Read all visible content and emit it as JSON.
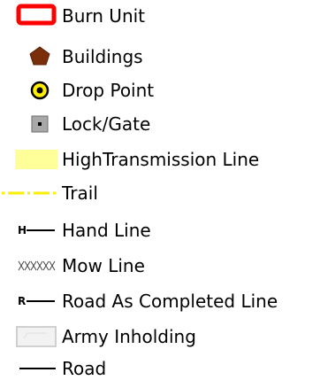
{
  "legend": {
    "items": [
      {
        "label": "Burn Unit",
        "icon": "burn-unit-icon",
        "color": "#ff0000"
      },
      {
        "label": "Buildings",
        "icon": "building-icon",
        "color": "#7a2e0a"
      },
      {
        "label": "Drop Point",
        "icon": "drop-point-icon",
        "color": "#ffee00"
      },
      {
        "label": "Lock/Gate",
        "icon": "lock-gate-icon",
        "color": "#a8a8a8"
      },
      {
        "label": "HighTransmission Line",
        "icon": "transmission-line-icon",
        "color": "#ffff99"
      },
      {
        "label": "Trail",
        "icon": "trail-icon",
        "color": "#ffee00"
      },
      {
        "label": "Hand Line",
        "icon": "hand-line-icon",
        "color": "#000000",
        "letter": "H"
      },
      {
        "label": "Mow Line",
        "icon": "mow-line-icon",
        "color": "#444444"
      },
      {
        "label": "Road As Completed Line",
        "icon": "road-completed-line-icon",
        "color": "#000000",
        "letter": "R"
      },
      {
        "label": "Army Inholding",
        "icon": "army-inholding-icon",
        "color": "#d9d9d9"
      },
      {
        "label": "Road",
        "icon": "road-icon",
        "color": "#000000"
      }
    ]
  }
}
